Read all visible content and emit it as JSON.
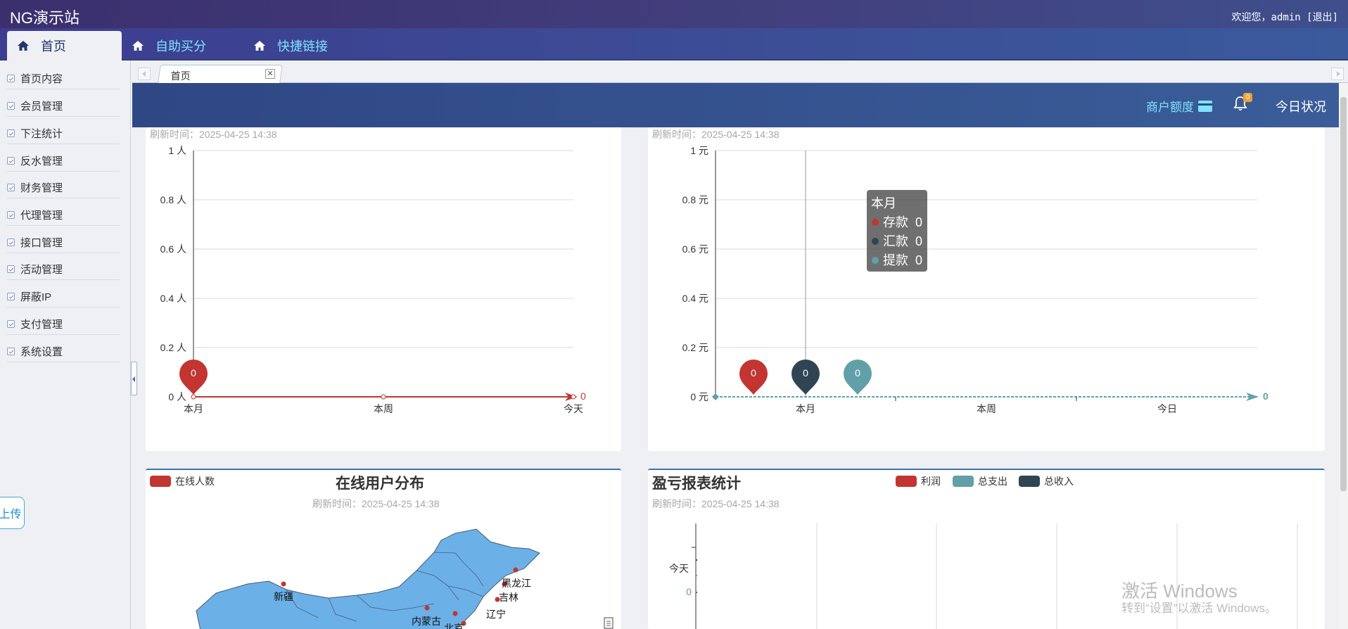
{
  "header": {
    "brand": "NG演示站",
    "welcome": "欢迎您，admin [",
    "logout": "退出",
    "welcome_end": "]"
  },
  "nav": {
    "tabs": [
      {
        "label": "首页",
        "icon": "home-icon",
        "active": true
      },
      {
        "label": "自助买分",
        "icon": "home-icon"
      },
      {
        "label": "快捷链接",
        "icon": "home-icon"
      }
    ]
  },
  "sidebar": {
    "items": [
      {
        "label": "首页内容"
      },
      {
        "label": "会员管理"
      },
      {
        "label": "下注统计"
      },
      {
        "label": "反水管理"
      },
      {
        "label": "财务管理"
      },
      {
        "label": "代理管理"
      },
      {
        "label": "接口管理"
      },
      {
        "label": "活动管理"
      },
      {
        "label": "屏蔽IP"
      },
      {
        "label": "支付管理"
      },
      {
        "label": "系统设置"
      }
    ],
    "upload": "上传"
  },
  "tabs": {
    "page_tab": "首页",
    "close_symbol": "✕"
  },
  "status_bar": {
    "quota": "商户额度",
    "bell_count": "0",
    "today_status": "今日状况"
  },
  "colors": {
    "red": "#c23531",
    "navy": "#2f4554",
    "teal": "#61a0a8",
    "accent": "#7fe3ff"
  },
  "charts": {
    "users": {
      "refresh": "刷新时间：2025-04-25 14:38",
      "y_ticks": [
        "1 人",
        "0.8 人",
        "0.6 人",
        "0.4 人",
        "0.2 人",
        "0 人"
      ],
      "x_ticks": [
        "本月",
        "本周",
        "今天"
      ],
      "pin_label": "0",
      "end_label": "0"
    },
    "finance": {
      "refresh": "刷新时间：2025-04-25 14:38",
      "y_ticks": [
        "1 元",
        "0.8 元",
        "0.6 元",
        "0.4 元",
        "0.2 元",
        "0 元"
      ],
      "x_ticks": [
        "本月",
        "本周",
        "今日"
      ],
      "pins": [
        "0",
        "0",
        "0"
      ],
      "end_label": "0",
      "tooltip": {
        "title": "本月",
        "rows": [
          {
            "name": "存款",
            "value": "0"
          },
          {
            "name": "汇款",
            "value": "0"
          },
          {
            "name": "提款",
            "value": "0"
          }
        ]
      }
    },
    "map": {
      "title": "在线用户分布",
      "refresh": "刷新时间：2025-04-25 14:38",
      "legend": "在线人数",
      "regions": [
        "新疆",
        "内蒙古",
        "黑龙江",
        "吉林",
        "辽宁",
        "北京"
      ]
    },
    "profit": {
      "title": "盈亏报表统计",
      "refresh": "刷新时间：2025-04-25 14:38",
      "legend": [
        "利润",
        "总支出",
        "总收入"
      ],
      "y_category": "今天",
      "value_label": "0"
    }
  },
  "chart_data": [
    {
      "type": "line",
      "categories": [
        "本月",
        "本周",
        "今天"
      ],
      "series": [
        {
          "values": [
            0,
            0,
            0
          ]
        }
      ],
      "ylim": [
        0,
        1
      ]
    },
    {
      "type": "bar",
      "categories": [
        "本月",
        "本周",
        "今日"
      ],
      "series": [
        {
          "name": "存款",
          "values": [
            0,
            0,
            0
          ]
        },
        {
          "name": "汇款",
          "values": [
            0,
            0,
            0
          ]
        },
        {
          "name": "提款",
          "values": [
            0,
            0,
            0
          ]
        }
      ],
      "ylim": [
        0,
        1
      ]
    },
    {
      "type": "bar",
      "categories": [
        "今天"
      ],
      "series": [
        {
          "name": "利润",
          "values": [
            0
          ]
        },
        {
          "name": "总支出",
          "values": [
            0
          ]
        },
        {
          "name": "总收入",
          "values": [
            0
          ]
        }
      ]
    }
  ],
  "watermark": {
    "line1": "激活 Windows",
    "line2": "转到“设置”以激活 Windows。"
  }
}
